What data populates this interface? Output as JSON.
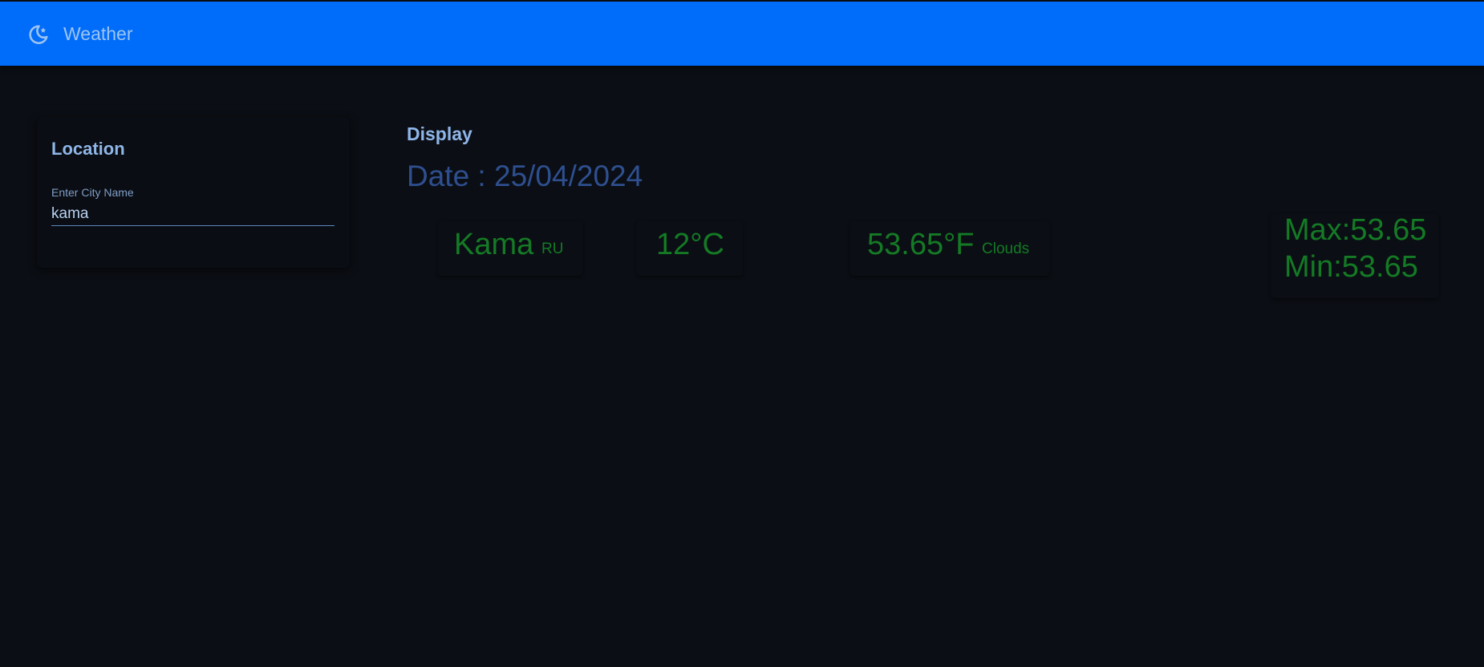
{
  "app": {
    "title": "Weather",
    "icon": "moon-stars-icon",
    "accent_color": "#006cfa"
  },
  "location": {
    "title": "Location",
    "field_label": "Enter City Name",
    "city_value": "kama"
  },
  "display": {
    "title": "Display",
    "date_text": "Date : 25/04/2024",
    "city": "Kama",
    "country": "RU",
    "temp_c": "12°C",
    "temp_f": "53.65°F",
    "condition": "Clouds",
    "max": "Max:53.65",
    "min": "Min:53.65",
    "value_color": "#147a25"
  }
}
